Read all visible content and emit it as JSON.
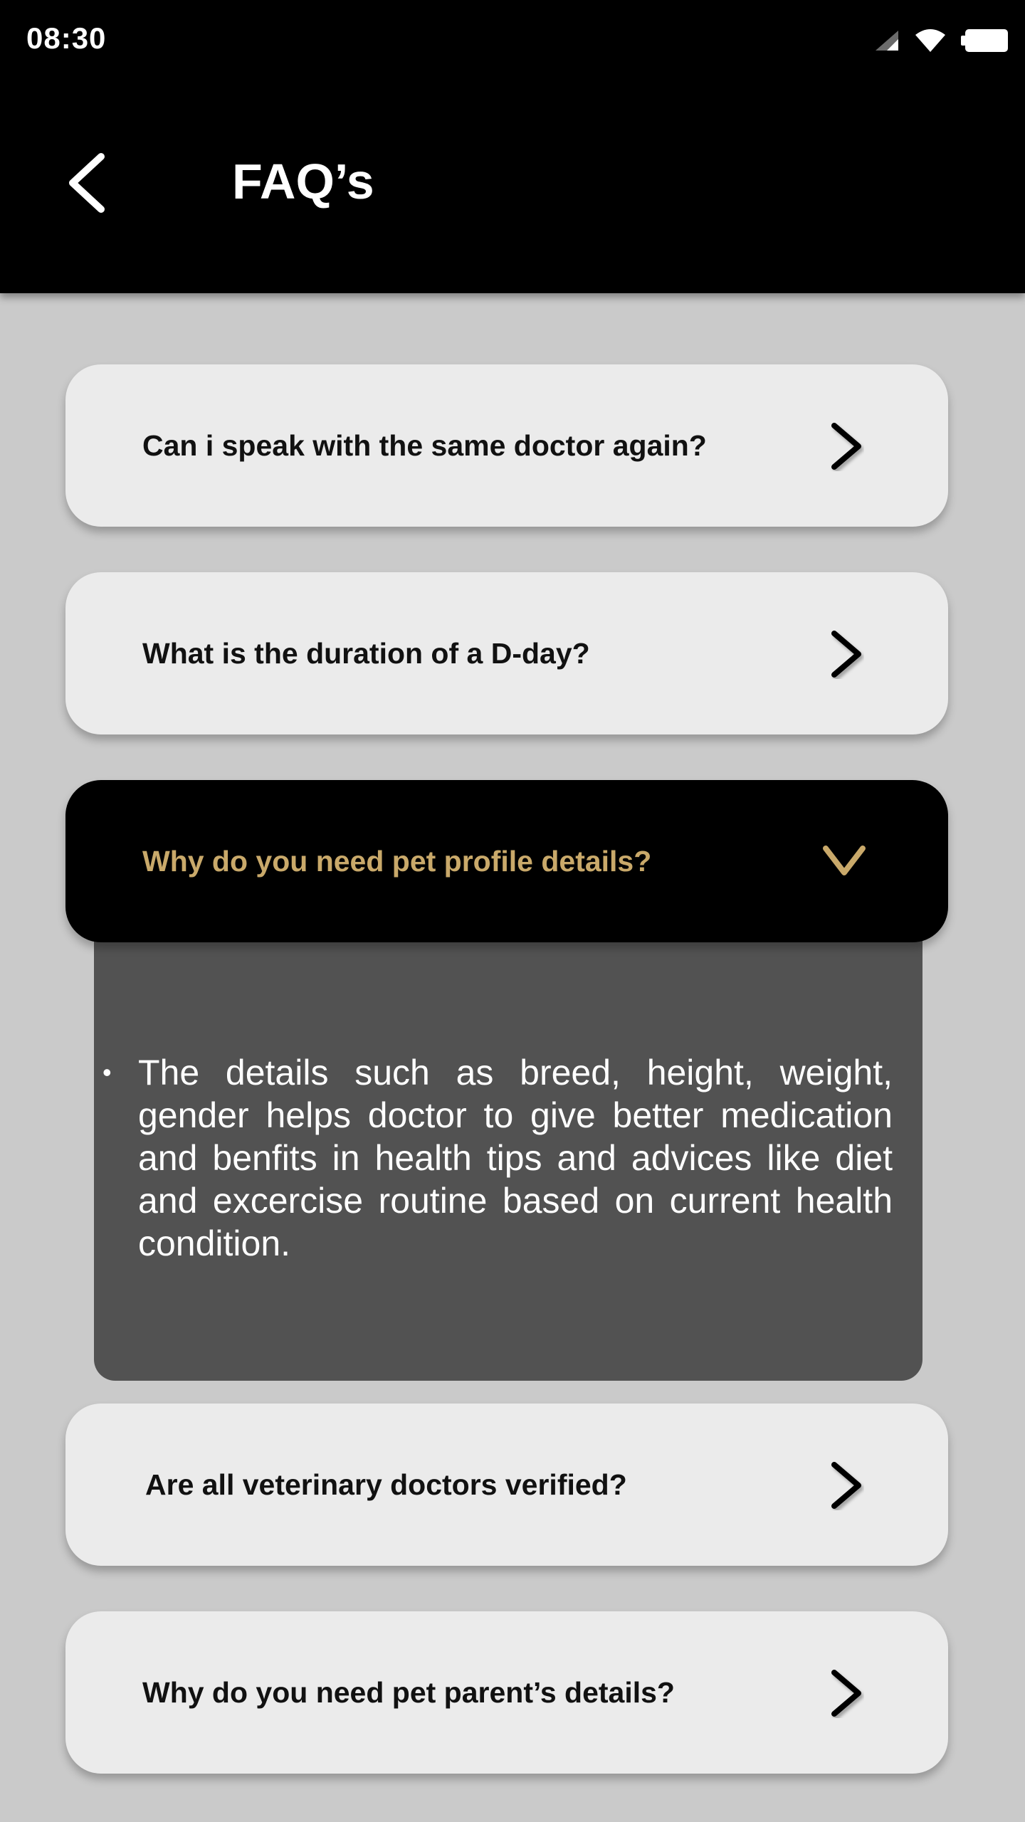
{
  "status_bar": {
    "time": "08:30",
    "icons": [
      "signal-icon",
      "wifi-icon",
      "battery-icon"
    ]
  },
  "app_bar": {
    "title": "FAQ’s",
    "back_icon": "chevron-left-icon"
  },
  "faqs": [
    {
      "question": "Can i speak with the same doctor again?",
      "expanded": false
    },
    {
      "question": "What is the duration of a D-day?",
      "expanded": false
    },
    {
      "question": "Why do you need pet profile details?",
      "expanded": true,
      "answer": "The details such as breed, height, weight, gender helps doctor to give better medication and benfits in health tips and advices like diet and excercise routine based on current health condition."
    },
    {
      "question": "Are all veterinary doctors verified?",
      "expanded": false
    },
    {
      "question": "Why do you need pet parent’s details?",
      "expanded": false
    }
  ],
  "colors": {
    "header": "#000000",
    "background": "#cacaca",
    "card": "#ebebeb",
    "accent_gold": "#c9a96a",
    "answer_panel": "#525252"
  }
}
